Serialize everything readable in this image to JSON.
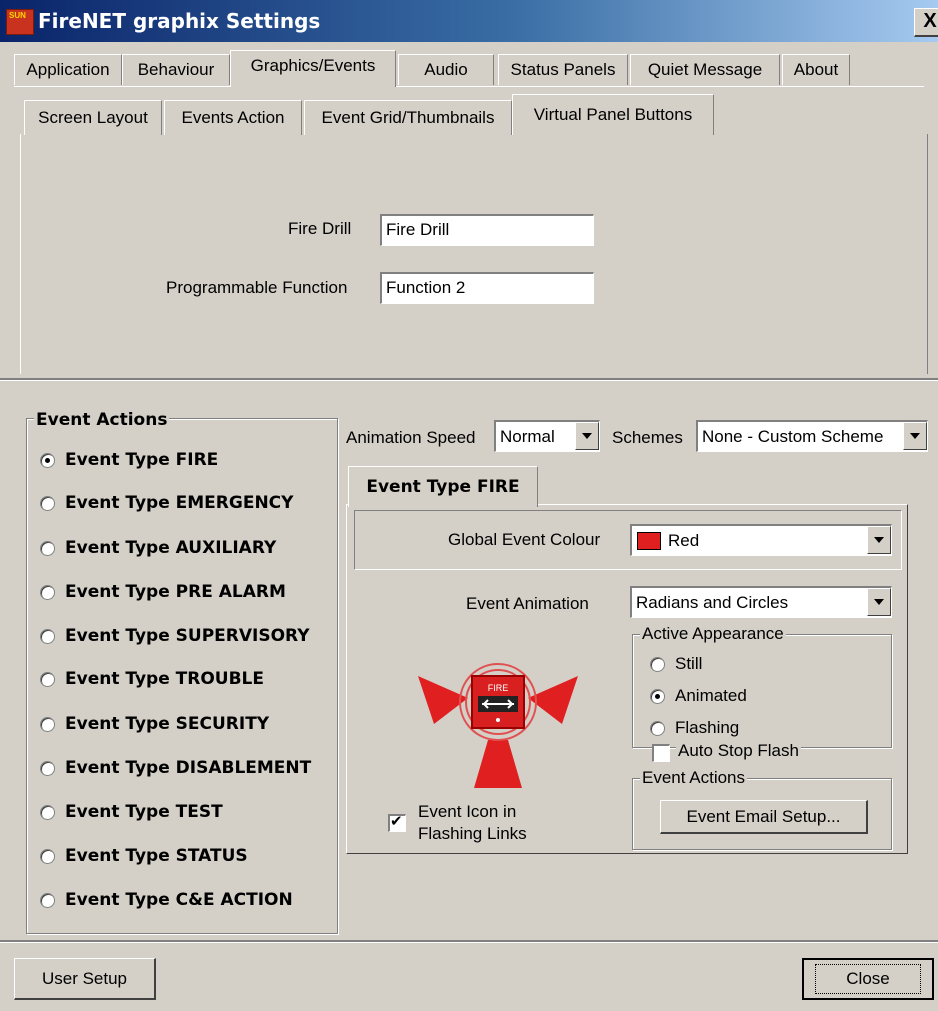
{
  "window": {
    "title": "FireNET graphix Settings",
    "close_glyph": "X",
    "app_icon_text": "SUN"
  },
  "top_tabs": [
    "Application",
    "Behaviour",
    "Graphics/Events",
    "Audio",
    "Status Panels",
    "Quiet Message",
    "About"
  ],
  "sub_tabs": [
    "Screen Layout",
    "Events Action",
    "Event Grid/Thumbnails",
    "Virtual Panel Buttons"
  ],
  "virtual_panel": {
    "fire_drill_label": "Fire Drill",
    "fire_drill_value": "Fire Drill",
    "prog_function_label": "Programmable Function",
    "prog_function_value": "Function 2"
  },
  "event_actions": {
    "title": "Event Actions",
    "items": [
      "Event Type FIRE",
      "Event Type EMERGENCY",
      "Event Type AUXILIARY",
      "Event Type PRE ALARM",
      "Event Type SUPERVISORY",
      "Event Type TROUBLE",
      "Event Type SECURITY",
      "Event Type DISABLEMENT",
      "Event Type TEST",
      "Event Type STATUS",
      "Event Type C&E ACTION"
    ],
    "selected_index": 0
  },
  "animation_speed": {
    "label": "Animation Speed",
    "value": "Normal"
  },
  "schemes": {
    "label": "Schemes",
    "value": "None - Custom Scheme"
  },
  "event_tab": {
    "tab_label": "Event Type FIRE",
    "global_colour_label": "Global Event Colour",
    "global_colour_value": "Red",
    "global_colour_hex": "#e02020",
    "event_animation_label": "Event Animation",
    "event_animation_value": "Radians and Circles",
    "active_appearance_title": "Active Appearance",
    "appearance_options": [
      "Still",
      "Animated",
      "Flashing"
    ],
    "appearance_selected": 1,
    "auto_stop_flash_label": "Auto Stop Flash",
    "auto_stop_flash_checked": false,
    "event_actions_title": "Event Actions",
    "email_button": "Event Email Setup...",
    "icon_flash_label_1": "Event Icon in",
    "icon_flash_label_2": "Flashing Links",
    "icon_flash_checked": true,
    "icon_text": "FIRE"
  },
  "footer": {
    "user_setup": "User Setup",
    "close": "Close"
  },
  "colors": {
    "face": "#d4d0c8",
    "title_start": "#0a246a",
    "accent_red": "#e02020"
  }
}
